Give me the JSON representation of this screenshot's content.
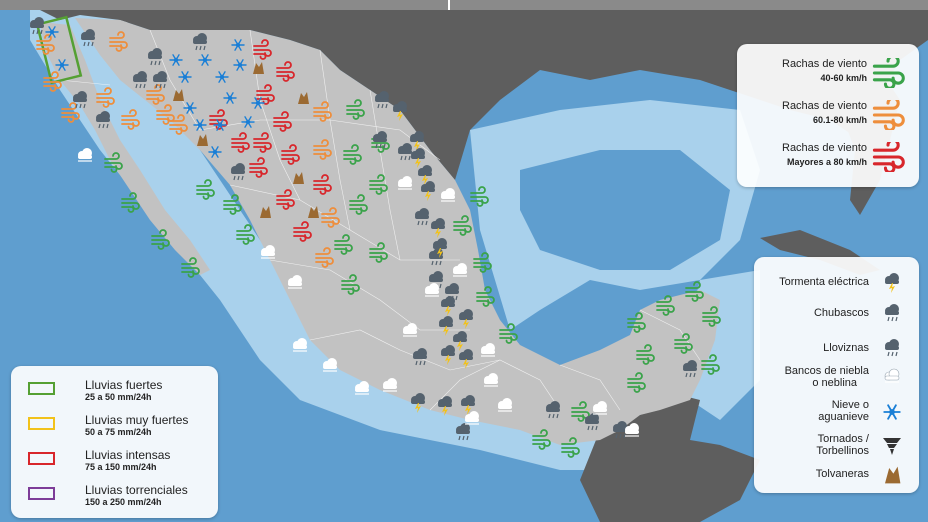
{
  "colors": {
    "ocean_deep": "#5f9ecf",
    "ocean_shelf": "#a9d1ec",
    "land_mexico": "#c2c2c2",
    "land_other": "#5e5e5e",
    "wind_40_60": "#3aa34a",
    "wind_60_80": "#ee8e3c",
    "wind_80plus": "#d8262b",
    "rain_fuertes": "#55a033",
    "rain_muy_fuertes": "#f2c21a",
    "rain_intensas": "#d8262b",
    "rain_torrenciales": "#7d3c98"
  },
  "wind_legend": [
    {
      "title": "Rachas de viento",
      "range": "40-60 km/h",
      "icon": "wind-icon-green",
      "color": "#3aa34a"
    },
    {
      "title": "Rachas de viento",
      "range": "60.1-80 km/h",
      "icon": "wind-icon-orange",
      "color": "#ee8e3c"
    },
    {
      "title": "Rachas de viento",
      "range": "Mayores a 80 km/h",
      "icon": "wind-icon-red",
      "color": "#d8262b"
    }
  ],
  "phenomena_legend": [
    {
      "label": "Tormenta eléctrica",
      "icon": "thunderstorm-icon"
    },
    {
      "label": "Chubascos",
      "icon": "showers-icon"
    },
    {
      "label": "Lloviznas",
      "icon": "drizzle-icon"
    },
    {
      "label_1": "Bancos de niebla",
      "label_2": "o neblina",
      "icon": "fog-icon"
    },
    {
      "label_1": "Nieve o",
      "label_2": "aguanieve",
      "icon": "snow-icon"
    },
    {
      "label_1": "Tornados /",
      "label_2": "Torbellinos",
      "icon": "tornado-icon"
    },
    {
      "label": "Tolvaneras",
      "icon": "dust-storm-icon"
    }
  ],
  "rain_legend": [
    {
      "title": "Lluvias fuertes",
      "range": "25 a 50 mm/24h",
      "color": "#55a033"
    },
    {
      "title": "Lluvias muy fuertes",
      "range": "50 a 75 mm/24h",
      "color": "#f2c21a"
    },
    {
      "title": "Lluvias intensas",
      "range": "75 a 150 mm/24h",
      "color": "#d8262b"
    },
    {
      "title": "Lluvias torrenciales",
      "range": "150 a 250 mm/24h",
      "color": "#7d3c98"
    }
  ]
}
